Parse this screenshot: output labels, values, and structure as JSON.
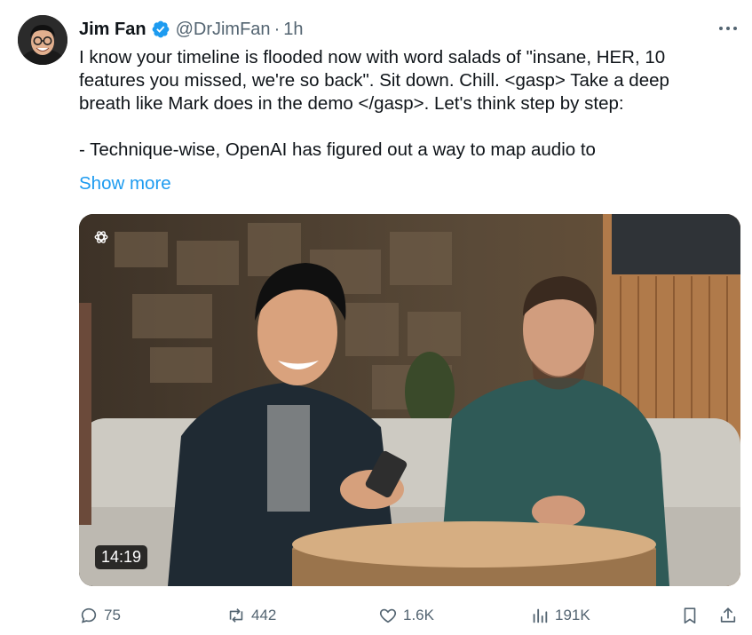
{
  "tweet": {
    "author_name": "Jim Fan",
    "handle": "@DrJimFan",
    "separator": "·",
    "time": "1h",
    "lines": [
      "I know your timeline is flooded now with word salads of \"insane, HER, 10",
      "features you missed, we're so back\". Sit down. Chill. <gasp> Take a deep",
      "breath like Mark does in the demo </gasp>. Let's think step by step:",
      "- Technique-wise, OpenAI has figured out a way to map audio to"
    ],
    "show_more": "Show more"
  },
  "media": {
    "duration": "14:19",
    "logo": "openai-logo-icon"
  },
  "metrics": {
    "replies": "75",
    "reposts": "442",
    "likes": "1.6K",
    "views": "191K"
  },
  "colors": {
    "text": "#0f1419",
    "muted": "#536471",
    "link": "#1d9bf0",
    "verified": "#1d9bf0"
  }
}
